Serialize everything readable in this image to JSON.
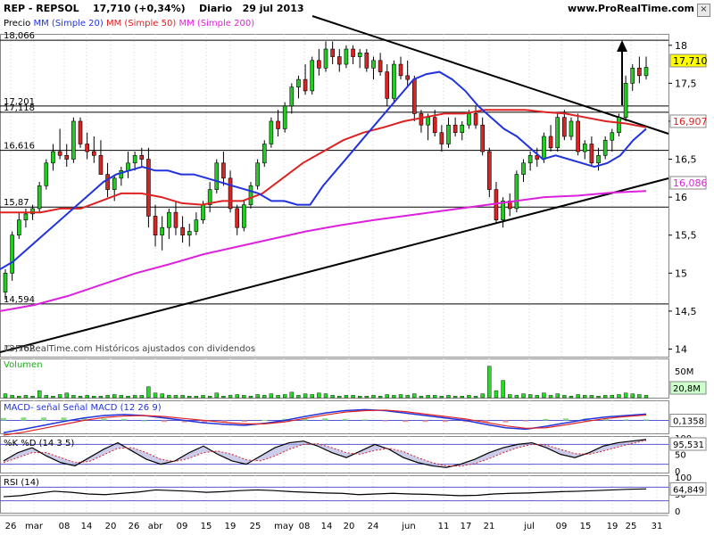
{
  "header": {
    "symbol": "REP - REPSOL",
    "last": "17,710 (+0,34%)",
    "period": "Diario",
    "date": "29 jul 2013",
    "site": "www.ProRealTime.com",
    "close_glyph": "×"
  },
  "price_panel": {
    "legend": [
      {
        "text": "Precio",
        "color": "#000000"
      },
      {
        "text": "MM (Simple 20)",
        "color": "#2233dd"
      },
      {
        "text": "MM (Simple 50)",
        "color": "#dd2222"
      },
      {
        "text": "MM (Simple 200)",
        "color": "#dd22dd"
      }
    ],
    "watermark": "© ProRealTime.com Históricos ajustados con dividendos",
    "overlap_label": "13,762",
    "level_labels": [
      "18,066",
      "17,201",
      "17,118",
      "16,616",
      "15,87",
      "14,594"
    ],
    "axis_ticks": [
      "18",
      "17,5",
      "17",
      "16,5",
      "16",
      "15,5",
      "15",
      "14,5",
      "14"
    ],
    "value_tags": [
      {
        "text": "17,710",
        "bg": "#ffff00",
        "color": "#000000"
      },
      {
        "text": "16,907",
        "bg": "#ffffff",
        "color": "#dd2222"
      },
      {
        "text": "16,086",
        "bg": "#ffffff",
        "color": "#dd22dd"
      }
    ]
  },
  "volume_panel": {
    "label": "Volumen",
    "axis_tick": "50M",
    "value_tag": "20,8M"
  },
  "macd_panel": {
    "label": "MACD- señal Señal MACD (12 26 9)",
    "value_tag": "0,1358"
  },
  "stoch_panel": {
    "label": "%K %D (14 3 5)",
    "axis_ticks": [
      "100",
      "50",
      "0"
    ],
    "value_tag": "95,531"
  },
  "rsi_panel": {
    "label": "RSI (14)",
    "axis_ticks": [
      "100",
      "50",
      "0"
    ],
    "value_tag": "64,849"
  },
  "x_axis": {
    "labels": [
      "26",
      "mar",
      "08",
      "14",
      "20",
      "26",
      "abr",
      "09",
      "15",
      "19",
      "25",
      "may",
      "08",
      "14",
      "20",
      "24",
      "jun",
      "11",
      "17",
      "21",
      "jul",
      "09",
      "15",
      "19",
      "25",
      "31"
    ]
  },
  "colors": {
    "up": "#22cc22",
    "down": "#dd2222",
    "ma20": "#2233dd",
    "ma50": "#dd2222",
    "ma200": "#dd22dd",
    "volume": "#22dd22"
  },
  "chart_data": {
    "type": "candlestick",
    "title": "REP - REPSOL",
    "ylim": [
      13.9,
      18.15
    ],
    "horizontal_levels": [
      18.066,
      17.201,
      17.118,
      16.616,
      15.87,
      14.594
    ],
    "candles": [
      [
        14.75,
        15.05,
        14.65,
        15.0
      ],
      [
        15.0,
        15.55,
        14.9,
        15.5
      ],
      [
        15.5,
        15.8,
        15.45,
        15.7
      ],
      [
        15.7,
        15.85,
        15.6,
        15.78
      ],
      [
        15.78,
        15.9,
        15.7,
        15.85
      ],
      [
        15.85,
        16.2,
        15.8,
        16.15
      ],
      [
        16.15,
        16.5,
        16.1,
        16.45
      ],
      [
        16.45,
        16.7,
        16.35,
        16.6
      ],
      [
        16.6,
        16.9,
        16.5,
        16.55
      ],
      [
        16.55,
        16.7,
        16.4,
        16.5
      ],
      [
        16.5,
        17.05,
        16.45,
        17.0
      ],
      [
        17.0,
        17.05,
        16.65,
        16.7
      ],
      [
        16.7,
        16.85,
        16.5,
        16.6
      ],
      [
        16.6,
        16.8,
        16.45,
        16.55
      ],
      [
        16.55,
        16.75,
        16.3,
        16.3
      ],
      [
        16.3,
        16.45,
        16.0,
        16.1
      ],
      [
        16.1,
        16.3,
        15.95,
        16.25
      ],
      [
        16.25,
        16.4,
        16.15,
        16.35
      ],
      [
        16.35,
        16.6,
        16.25,
        16.45
      ],
      [
        16.45,
        16.6,
        16.35,
        16.55
      ],
      [
        16.55,
        16.65,
        16.4,
        16.5
      ],
      [
        16.5,
        16.65,
        15.6,
        15.75
      ],
      [
        15.75,
        15.9,
        15.35,
        15.5
      ],
      [
        15.5,
        15.75,
        15.3,
        15.6
      ],
      [
        15.6,
        15.85,
        15.45,
        15.8
      ],
      [
        15.8,
        15.95,
        15.5,
        15.6
      ],
      [
        15.6,
        15.75,
        15.4,
        15.5
      ],
      [
        15.5,
        15.65,
        15.35,
        15.55
      ],
      [
        15.55,
        15.8,
        15.5,
        15.7
      ],
      [
        15.7,
        15.95,
        15.65,
        15.9
      ],
      [
        15.9,
        16.2,
        15.8,
        16.1
      ],
      [
        16.1,
        16.5,
        16.05,
        16.45
      ],
      [
        16.45,
        16.6,
        16.15,
        16.25
      ],
      [
        16.25,
        16.35,
        15.8,
        15.85
      ],
      [
        15.85,
        15.9,
        15.5,
        15.6
      ],
      [
        15.6,
        15.95,
        15.55,
        15.9
      ],
      [
        15.9,
        16.2,
        15.85,
        16.15
      ],
      [
        16.15,
        16.5,
        16.1,
        16.45
      ],
      [
        16.45,
        16.75,
        16.4,
        16.7
      ],
      [
        16.7,
        17.05,
        16.65,
        17.0
      ],
      [
        17.0,
        17.15,
        16.8,
        16.9
      ],
      [
        16.9,
        17.25,
        16.85,
        17.2
      ],
      [
        17.2,
        17.5,
        17.1,
        17.45
      ],
      [
        17.45,
        17.6,
        17.3,
        17.55
      ],
      [
        17.55,
        17.75,
        17.35,
        17.4
      ],
      [
        17.4,
        17.85,
        17.35,
        17.8
      ],
      [
        17.8,
        17.95,
        17.6,
        17.7
      ],
      [
        17.7,
        18.05,
        17.65,
        17.95
      ],
      [
        17.95,
        18.05,
        17.75,
        17.85
      ],
      [
        17.85,
        17.95,
        17.65,
        17.75
      ],
      [
        17.75,
        18.0,
        17.7,
        17.95
      ],
      [
        17.95,
        18.0,
        17.75,
        17.85
      ],
      [
        17.85,
        17.95,
        17.7,
        17.9
      ],
      [
        17.9,
        17.95,
        17.65,
        17.7
      ],
      [
        17.7,
        17.85,
        17.55,
        17.8
      ],
      [
        17.8,
        17.9,
        17.6,
        17.65
      ],
      [
        17.65,
        17.75,
        17.2,
        17.3
      ],
      [
        17.3,
        17.8,
        17.25,
        17.75
      ],
      [
        17.75,
        17.85,
        17.55,
        17.6
      ],
      [
        17.6,
        17.8,
        17.45,
        17.55
      ],
      [
        17.55,
        17.6,
        17.0,
        17.1
      ],
      [
        17.1,
        17.15,
        16.85,
        16.95
      ],
      [
        16.95,
        17.1,
        16.75,
        17.05
      ],
      [
        17.05,
        17.15,
        16.8,
        16.85
      ],
      [
        16.85,
        16.95,
        16.6,
        16.7
      ],
      [
        16.7,
        17.05,
        16.65,
        16.95
      ],
      [
        16.95,
        17.05,
        16.8,
        16.85
      ],
      [
        16.85,
        17.0,
        16.75,
        16.95
      ],
      [
        16.95,
        17.15,
        16.9,
        17.1
      ],
      [
        17.1,
        17.2,
        16.9,
        16.95
      ],
      [
        16.95,
        17.05,
        16.55,
        16.6
      ],
      [
        16.6,
        16.65,
        16.0,
        16.1
      ],
      [
        16.1,
        16.2,
        15.65,
        15.7
      ],
      [
        15.7,
        16.0,
        15.6,
        15.95
      ],
      [
        15.95,
        16.05,
        15.75,
        15.85
      ],
      [
        15.85,
        16.35,
        15.8,
        16.3
      ],
      [
        16.3,
        16.5,
        16.2,
        16.45
      ],
      [
        16.45,
        16.6,
        16.35,
        16.55
      ],
      [
        16.55,
        16.65,
        16.4,
        16.5
      ],
      [
        16.5,
        16.85,
        16.45,
        16.8
      ],
      [
        16.8,
        16.95,
        16.6,
        16.65
      ],
      [
        16.65,
        17.1,
        16.6,
        17.05
      ],
      [
        17.05,
        17.15,
        16.75,
        16.8
      ],
      [
        16.8,
        17.05,
        16.75,
        17.0
      ],
      [
        17.0,
        17.1,
        16.55,
        16.6
      ],
      [
        16.6,
        16.75,
        16.5,
        16.7
      ],
      [
        16.7,
        16.8,
        16.4,
        16.45
      ],
      [
        16.45,
        16.65,
        16.35,
        16.55
      ],
      [
        16.55,
        16.8,
        16.5,
        16.75
      ],
      [
        16.75,
        16.9,
        16.6,
        16.85
      ],
      [
        16.85,
        17.1,
        16.8,
        17.05
      ],
      [
        17.05,
        17.6,
        17.0,
        17.5
      ],
      [
        17.5,
        17.75,
        17.4,
        17.7
      ],
      [
        17.7,
        17.85,
        17.5,
        17.6
      ],
      [
        17.6,
        17.85,
        17.55,
        17.71
      ]
    ],
    "volume": [
      5,
      3,
      2,
      3,
      2,
      9,
      3,
      2,
      4,
      6,
      3,
      2,
      3,
      2,
      2,
      3,
      4,
      3,
      2,
      3,
      3,
      14,
      6,
      5,
      3,
      3,
      3,
      2,
      2,
      3,
      2,
      6,
      2,
      3,
      4,
      3,
      2,
      4,
      3,
      5,
      3,
      4,
      7,
      3,
      5,
      4,
      6,
      5,
      3,
      2,
      3,
      3,
      2,
      2,
      3,
      2,
      4,
      3,
      4,
      3,
      5,
      2,
      3,
      3,
      2,
      3,
      2,
      2,
      3,
      2,
      5,
      40,
      9,
      22,
      4,
      3,
      5,
      4,
      3,
      6,
      3,
      5,
      3,
      2,
      4,
      3,
      3,
      2,
      3,
      3,
      4,
      6,
      5,
      4,
      3
    ],
    "ma20": [
      15.05,
      15.15,
      15.3,
      15.45,
      15.6,
      15.75,
      15.9,
      16.05,
      16.2,
      16.3,
      16.35,
      16.4,
      16.35,
      16.35,
      16.3,
      16.3,
      16.25,
      16.2,
      16.15,
      16.1,
      16.05,
      15.95,
      15.95,
      15.9,
      15.9,
      16.15,
      16.35,
      16.55,
      16.75,
      16.95,
      17.15,
      17.35,
      17.55,
      17.62,
      17.65,
      17.55,
      17.4,
      17.2,
      17.05,
      16.9,
      16.8,
      16.65,
      16.5,
      16.55,
      16.5,
      16.45,
      16.4,
      16.45,
      16.55,
      16.75,
      16.9
    ],
    "ma50": [
      15.8,
      15.8,
      15.8,
      15.85,
      15.85,
      15.95,
      16.05,
      16.05,
      16.0,
      15.92,
      15.9,
      15.95,
      15.95,
      16.05,
      16.25,
      16.45,
      16.6,
      16.75,
      16.85,
      16.92,
      17.0,
      17.05,
      17.1,
      17.1,
      17.15,
      17.15,
      17.15,
      17.12,
      17.1,
      17.05,
      17.0,
      16.97,
      16.92
    ],
    "ma200": [
      14.5,
      14.58,
      14.7,
      14.85,
      15.0,
      15.12,
      15.25,
      15.35,
      15.45,
      15.55,
      15.63,
      15.7,
      15.76,
      15.82,
      15.88,
      15.94,
      16.0,
      16.02,
      16.06,
      16.08
    ],
    "macd": [
      -0.25,
      -0.18,
      -0.1,
      -0.02,
      0.05,
      0.1,
      0.12,
      0.1,
      0.05,
      0.0,
      -0.05,
      -0.08,
      -0.1,
      -0.06,
      0.0,
      0.08,
      0.15,
      0.2,
      0.22,
      0.2,
      0.15,
      0.1,
      0.05,
      0.0,
      -0.08,
      -0.15,
      -0.18,
      -0.12,
      -0.05,
      0.02,
      0.07,
      0.1,
      0.13
    ],
    "signal": [
      -0.3,
      -0.24,
      -0.16,
      -0.08,
      0.0,
      0.06,
      0.09,
      0.1,
      0.08,
      0.04,
      0.0,
      -0.04,
      -0.07,
      -0.07,
      -0.03,
      0.04,
      0.11,
      0.17,
      0.2,
      0.21,
      0.18,
      0.13,
      0.08,
      0.03,
      -0.04,
      -0.11,
      -0.16,
      -0.15,
      -0.09,
      -0.02,
      0.04,
      0.08,
      0.11
    ],
    "stoch_k": [
      30,
      55,
      70,
      45,
      25,
      15,
      40,
      65,
      85,
      60,
      35,
      20,
      30,
      55,
      75,
      50,
      30,
      20,
      45,
      70,
      85,
      90,
      75,
      55,
      40,
      60,
      80,
      65,
      40,
      25,
      15,
      10,
      20,
      35,
      55,
      70,
      80,
      85,
      70,
      50,
      40,
      55,
      75,
      85,
      90,
      95
    ],
    "stoch_d": [
      25,
      40,
      55,
      55,
      40,
      25,
      28,
      48,
      68,
      70,
      55,
      35,
      28,
      38,
      55,
      60,
      50,
      33,
      30,
      45,
      65,
      80,
      82,
      70,
      55,
      50,
      62,
      68,
      58,
      40,
      25,
      15,
      14,
      22,
      37,
      55,
      70,
      80,
      78,
      65,
      52,
      50,
      60,
      72,
      83,
      92
    ],
    "rsi": [
      42,
      45,
      52,
      58,
      55,
      50,
      48,
      52,
      56,
      62,
      60,
      58,
      55,
      57,
      60,
      62,
      60,
      57,
      55,
      53,
      52,
      48,
      50,
      52,
      50,
      49,
      47,
      45,
      46,
      50,
      52,
      53,
      55,
      57,
      58,
      60,
      62,
      64,
      65
    ]
  }
}
